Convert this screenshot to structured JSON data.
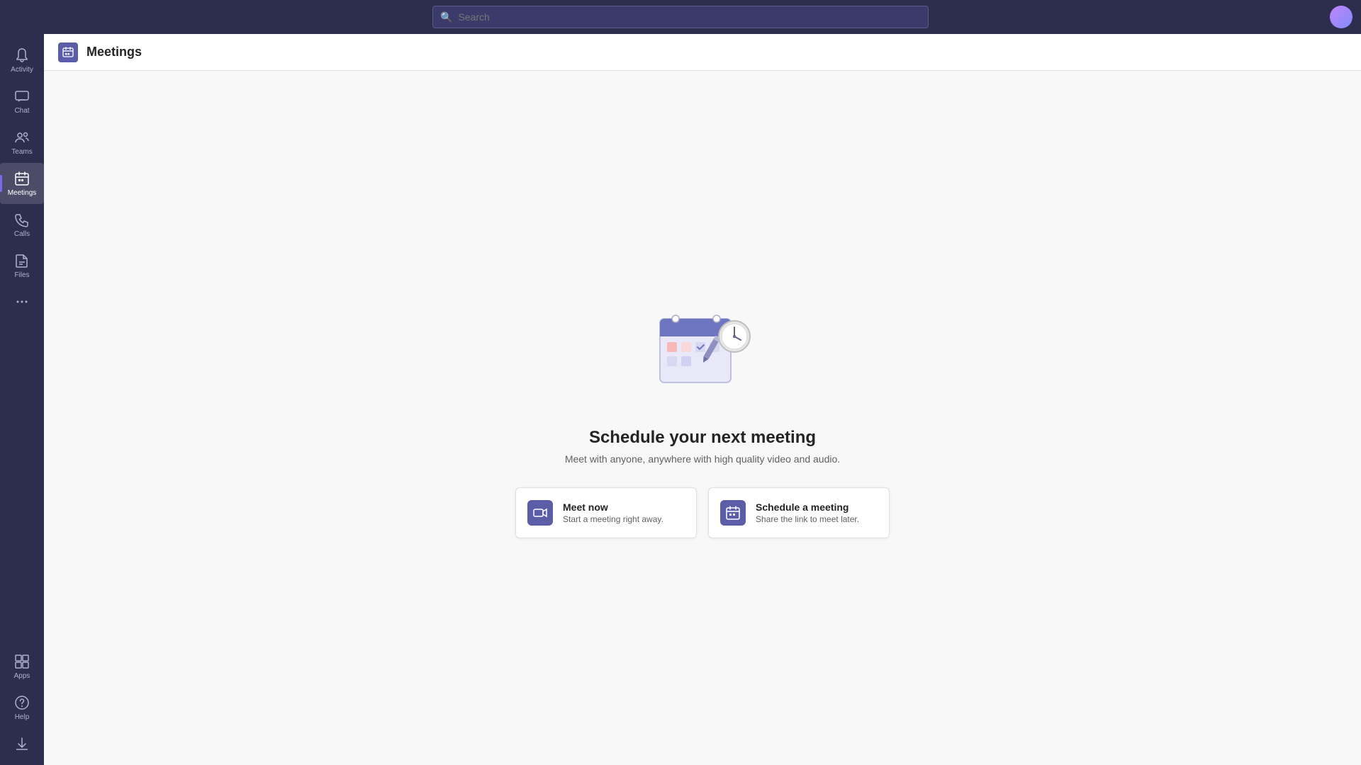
{
  "topbar": {
    "search_placeholder": "Search"
  },
  "sidebar": {
    "items": [
      {
        "id": "activity",
        "label": "Activity",
        "icon": "🔔"
      },
      {
        "id": "chat",
        "label": "Chat",
        "icon": "💬"
      },
      {
        "id": "teams",
        "label": "Teams",
        "icon": "👥"
      },
      {
        "id": "meetings",
        "label": "Meetings",
        "icon": "📅",
        "active": true
      },
      {
        "id": "calls",
        "label": "Calls",
        "icon": "📞"
      },
      {
        "id": "files",
        "label": "Files",
        "icon": "📄"
      },
      {
        "id": "more",
        "label": "...",
        "icon": "···"
      }
    ],
    "bottom_items": [
      {
        "id": "apps",
        "label": "Apps",
        "icon": "⊞"
      },
      {
        "id": "help",
        "label": "Help",
        "icon": "❓"
      }
    ],
    "download_label": "Download"
  },
  "page": {
    "title": "Meetings",
    "heading": "Schedule your next meeting",
    "subheading": "Meet with anyone, anywhere with high quality video and audio.",
    "actions": [
      {
        "id": "meet-now",
        "title": "Meet now",
        "subtitle": "Start a meeting right away.",
        "icon": "📹"
      },
      {
        "id": "schedule-meeting",
        "title": "Schedule a meeting",
        "subtitle": "Share the link to meet later.",
        "icon": "📅"
      }
    ]
  }
}
